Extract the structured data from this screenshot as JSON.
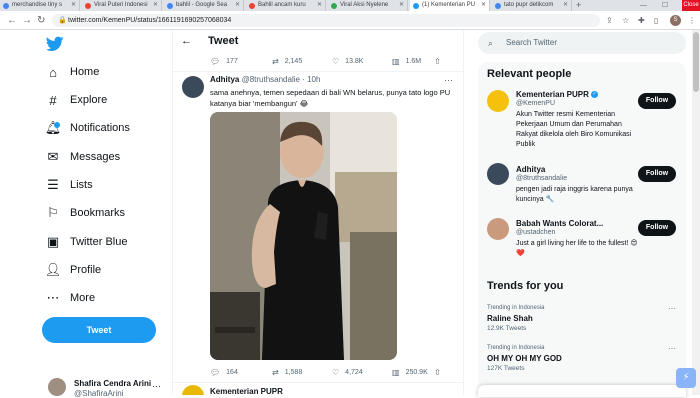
{
  "browser": {
    "tabs": [
      {
        "label": "merchandise tiny s",
        "color": "#4285f4"
      },
      {
        "label": "Viral Puteri Indonesi",
        "color": "#ea4335"
      },
      {
        "label": "bahlil - Google Sea",
        "color": "#4285f4"
      },
      {
        "label": "Bahlil ancam kuru",
        "color": "#ea4335"
      },
      {
        "label": "Viral Aksi Nyelene",
        "color": "#34a853"
      },
      {
        "label": "(1) Kementerian PU",
        "color": "#1d9bf0"
      },
      {
        "label": "tato pupr detikcom",
        "color": "#4285f4"
      }
    ],
    "close_label": "Close",
    "url": "twitter.com/KemenPU/status/1661191690257068034",
    "profile_initial": "S"
  },
  "nav": {
    "items": [
      {
        "label": "Home",
        "icon": "home-icon"
      },
      {
        "label": "Explore",
        "icon": "hashtag-icon"
      },
      {
        "label": "Notifications",
        "icon": "bell-icon"
      },
      {
        "label": "Messages",
        "icon": "mail-icon"
      },
      {
        "label": "Lists",
        "icon": "list-icon"
      },
      {
        "label": "Bookmarks",
        "icon": "bookmark-icon"
      },
      {
        "label": "Twitter Blue",
        "icon": "twitter-blue-icon"
      },
      {
        "label": "Profile",
        "icon": "profile-icon"
      },
      {
        "label": "More",
        "icon": "more-circle-icon"
      }
    ],
    "tweet_button": "Tweet",
    "account": {
      "name": "Shafira Cendra Arini",
      "handle": "@ShafiraArini"
    }
  },
  "main": {
    "title": "Tweet",
    "parent_actions": {
      "replies": "177",
      "retweets": "2,145",
      "likes": "13.8K",
      "views": "1.6M"
    },
    "tweet": {
      "name": "Adhitya",
      "handle": "@8truthsandalie",
      "time": "· 10h",
      "text": "sama anehnya, temen sepedaan di bali WN belarus, punya tato logo PU katanya biar 'membangun' 😂",
      "actions": {
        "replies": "164",
        "retweets": "1,588",
        "likes": "4,724",
        "views": "250.9K"
      }
    },
    "next_tweet_name": "Kementerian PUPR"
  },
  "sidebar": {
    "search_placeholder": "Search Twitter",
    "relevant_title": "Relevant people",
    "people": [
      {
        "name": "Kementerian PUPR",
        "handle": "@KemenPU",
        "bio": "Akun Twitter resmi Kementerian Pekerjaan Umum dan Perumahan Rakyat dikelola oleh Biro Komunikasi Publik",
        "follow": "Follow",
        "verified": true
      },
      {
        "name": "Adhitya",
        "handle": "@8truthsandalie",
        "bio": "pengen jadi raja inggris karena punya kuncinya 🔧",
        "follow": "Follow",
        "verified": false
      },
      {
        "name": "Babah Wants Colorat...",
        "handle": "@ustadchen",
        "bio": "Just a girl living her life to the fullest! 😍❤️",
        "follow": "Follow",
        "verified": false
      }
    ],
    "trends_title": "Trends for you",
    "trends": [
      {
        "meta": "Trending in Indonesia",
        "name": "Raline Shah",
        "count": "12.9K Tweets"
      },
      {
        "meta": "Trending in Indonesia",
        "name": "OH MY OH MY GOD",
        "count": "127K Tweets"
      }
    ]
  },
  "colors": {
    "accent": "#1d9bf0",
    "text": "#0f1419",
    "muted": "#536471"
  }
}
